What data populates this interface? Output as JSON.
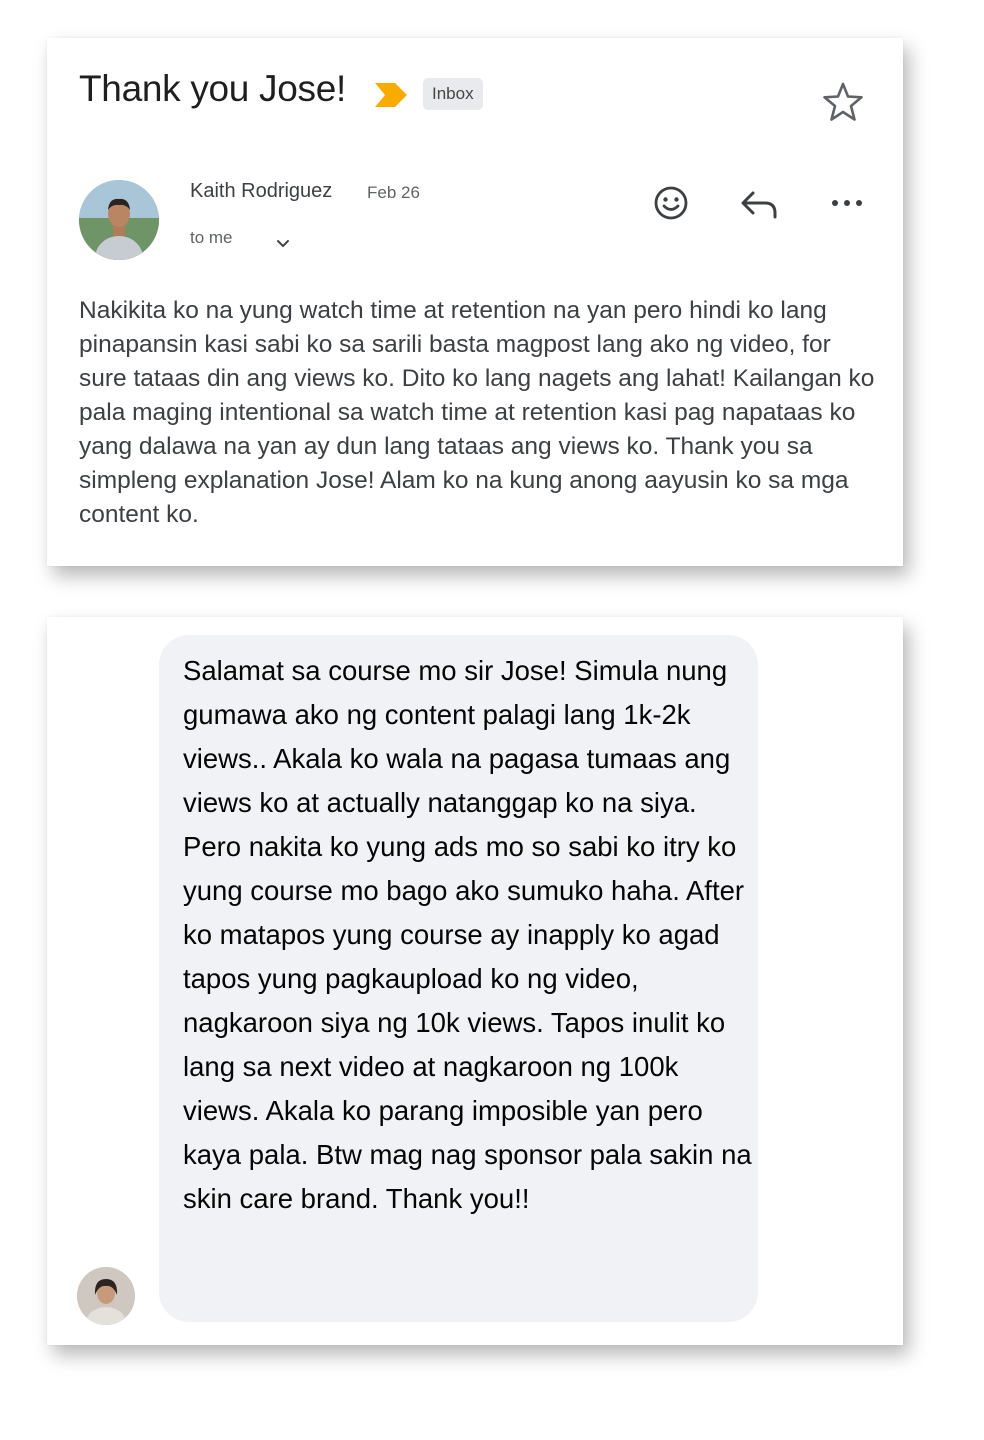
{
  "email": {
    "subject": "Thank you Jose!",
    "label": "Inbox",
    "sender_name": "Kaith Rodriguez",
    "date": "Feb 26",
    "recipient": "to me",
    "body": "Nakikita ko na yung watch time at retention na yan pero hindi ko lang pinapansin kasi sabi ko sa sarili basta magpost lang ako ng video, for sure tataas din ang views ko. Dito ko lang nagets ang lahat! Kailangan ko pala maging intentional sa watch time at retention kasi pag napataas ko yang dalawa na yan ay dun lang tataas ang views ko. Thank you sa simpleng explanation Jose! Alam ko na kung anong aayusin ko sa mga content ko.",
    "icons": {
      "importance": "importance-marker-icon",
      "star": "star-icon",
      "expand": "chevron-down-icon",
      "emoji": "emoji-smile-icon",
      "reply": "reply-icon",
      "more": "more-horizontal-icon"
    },
    "colors": {
      "importance_marker": "#f9ab00",
      "badge_bg": "#e8eaed"
    }
  },
  "chat": {
    "message": "Salamat sa course mo sir Jose! Simula nung gumawa ako ng content palagi lang 1k-2k views.. Akala ko wala na pagasa tumaas ang views ko at actually natanggap ko na siya. Pero nakita ko yung ads mo so sabi ko itry ko yung course mo bago ako sumuko haha. After ko matapos yung course ay inapply ko agad tapos yung pagkaupload ko ng video, nagkaroon siya ng 10k views. Tapos inulit ko lang sa next video at nagkaroon ng 100k views. Akala ko parang imposible yan pero kaya pala. Btw mag nag sponsor pala sakin na skin care brand. Thank you!!",
    "colors": {
      "bubble_bg": "#f0f2f5"
    }
  }
}
